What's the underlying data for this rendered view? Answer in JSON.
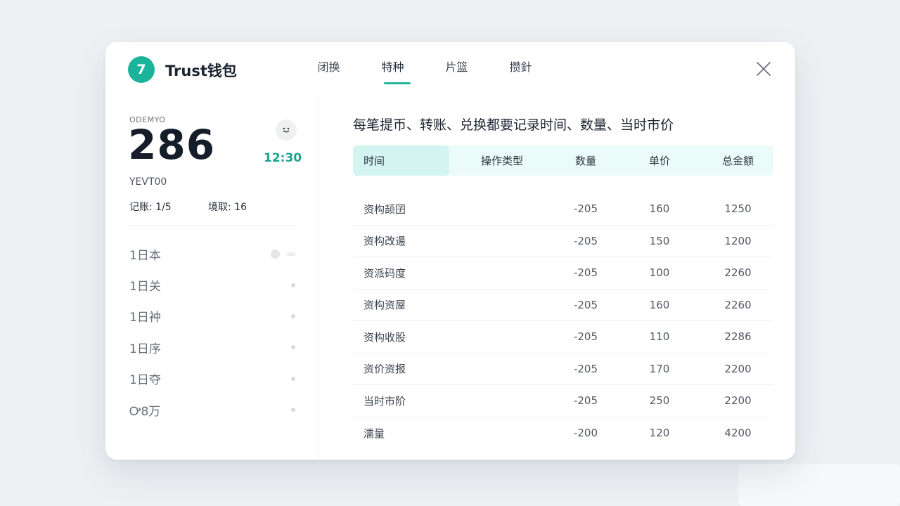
{
  "app": {
    "title": "Trust钱包",
    "logo_text": "7"
  },
  "tabs": [
    {
      "label": "闭换",
      "active": false
    },
    {
      "label": "特种",
      "active": true
    },
    {
      "label": "片篮",
      "active": false
    },
    {
      "label": "攒針",
      "active": false
    }
  ],
  "sidebar": {
    "caption": "ODEMYO",
    "big_number": "286",
    "time": "12:30",
    "subtitle": "YEVT00",
    "stat1": "记账: 1/5",
    "stat2": "境取: 16",
    "items": [
      {
        "label": "1日本",
        "marker": "toggle",
        "tiny": "ooi"
      },
      {
        "label": "1日关",
        "marker": "dot"
      },
      {
        "label": "1日衶",
        "marker": "dot"
      },
      {
        "label": "1日序",
        "marker": "dot"
      },
      {
        "label": "1日夺",
        "marker": "dot"
      },
      {
        "label": "Ꭴ8万",
        "marker": "dot"
      }
    ]
  },
  "main": {
    "title": "每笔提币、转账、兑换都要记录时间、数量、当时市价",
    "columns": [
      "时间",
      "操作类型",
      "数量",
      "单价",
      "总金额"
    ],
    "rows": [
      [
        "资构颉囝",
        "",
        "-205",
        "160",
        "1250"
      ],
      [
        "资构改逿",
        "",
        "-205",
        "150",
        "1200"
      ],
      [
        "资派码度",
        "",
        "-205",
        "100",
        "2260"
      ],
      [
        "资构资屋",
        "",
        "-205",
        "160",
        "2260"
      ],
      [
        "资构收股",
        "",
        "-205",
        "110",
        "2286"
      ],
      [
        "资价资报",
        "",
        "-205",
        "170",
        "2200"
      ],
      [
        "当时市阶",
        "",
        "-205",
        "250",
        "2200"
      ],
      [
        "濡量",
        "",
        "-200",
        "120",
        "4200"
      ]
    ]
  },
  "colors": {
    "accent": "#1cb39b",
    "header_highlight": "#d3f4f0",
    "header_bg": "#ebfbf9"
  },
  "icons": {
    "close": "close-icon",
    "avatar": "face-icon"
  }
}
